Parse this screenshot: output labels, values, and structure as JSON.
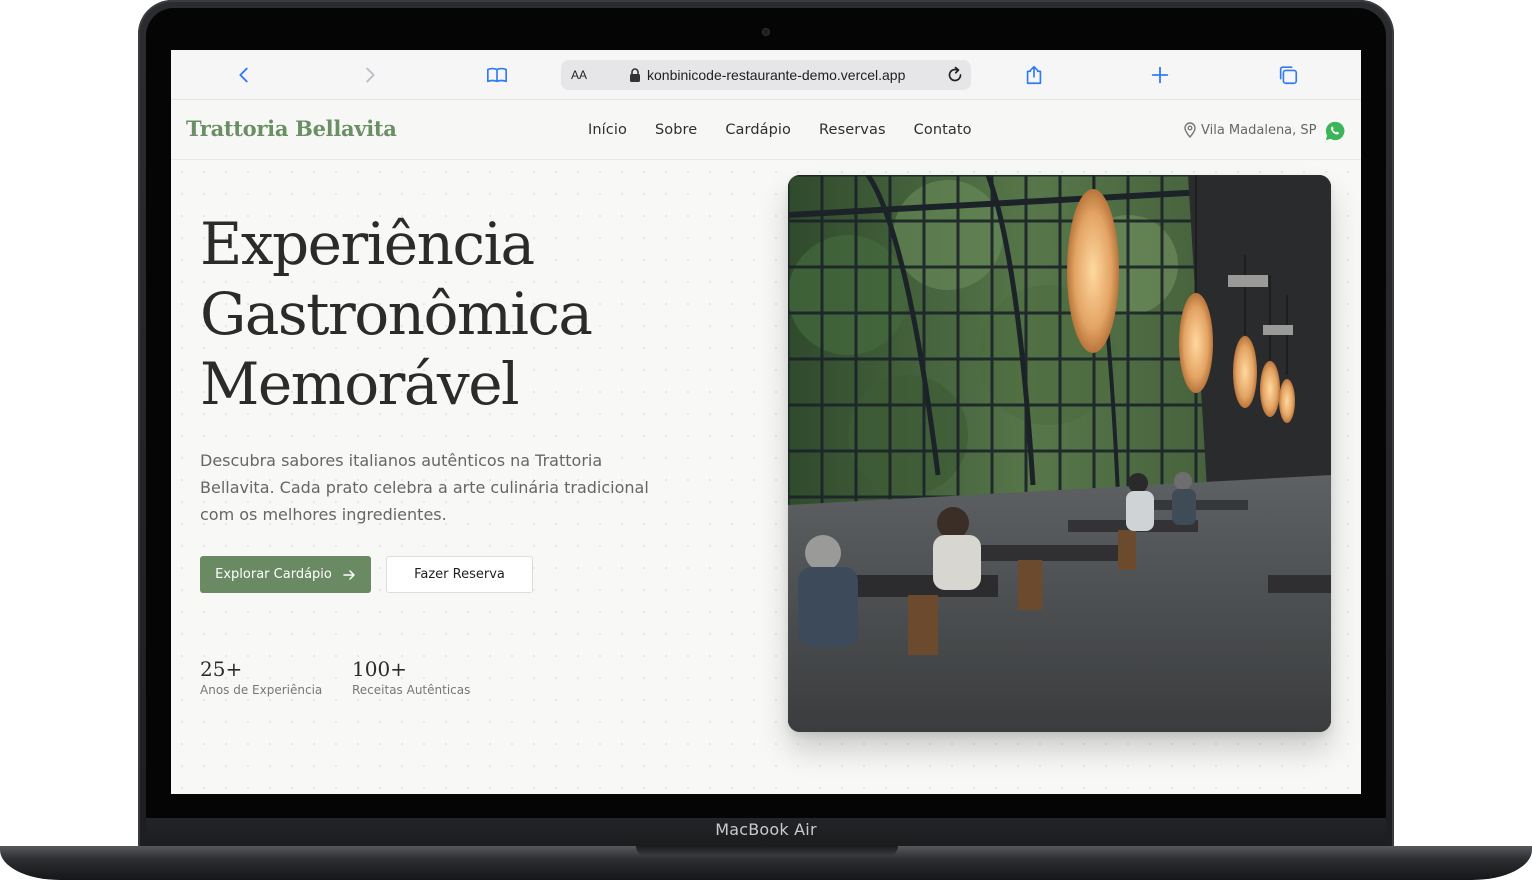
{
  "device": {
    "label": "MacBook Air"
  },
  "browser": {
    "url_text_size": "AA",
    "url": "konbinicode-restaurante-demo.vercel.app",
    "icons": [
      "back-icon",
      "forward-icon",
      "bookmarks-icon",
      "lock-icon",
      "reload-icon",
      "share-icon",
      "new-tab-icon",
      "tabs-icon"
    ]
  },
  "header": {
    "brand": "Trattoria Bellavita",
    "nav": [
      "Início",
      "Sobre",
      "Cardápio",
      "Reservas",
      "Contato"
    ],
    "location": "Vila Madalena, SP"
  },
  "hero": {
    "title_lines": [
      "Experiência",
      "Gastronômica",
      "Memorável"
    ],
    "description": "Descubra sabores italianos autênticos na Trattoria Bellavita. Cada prato celebra a arte culinária tradicional com os melhores ingredientes.",
    "primary_button": "Explorar Cardápio",
    "secondary_button": "Fazer Reserva",
    "stats": [
      {
        "value": "25+",
        "label": "Anos de Experiência"
      },
      {
        "value": "100+",
        "label": "Receitas Autênticas"
      }
    ]
  },
  "colors": {
    "brand_green": "#6a8f64",
    "button_green": "#6a8a64",
    "safari_blue": "#2f7bf6"
  }
}
